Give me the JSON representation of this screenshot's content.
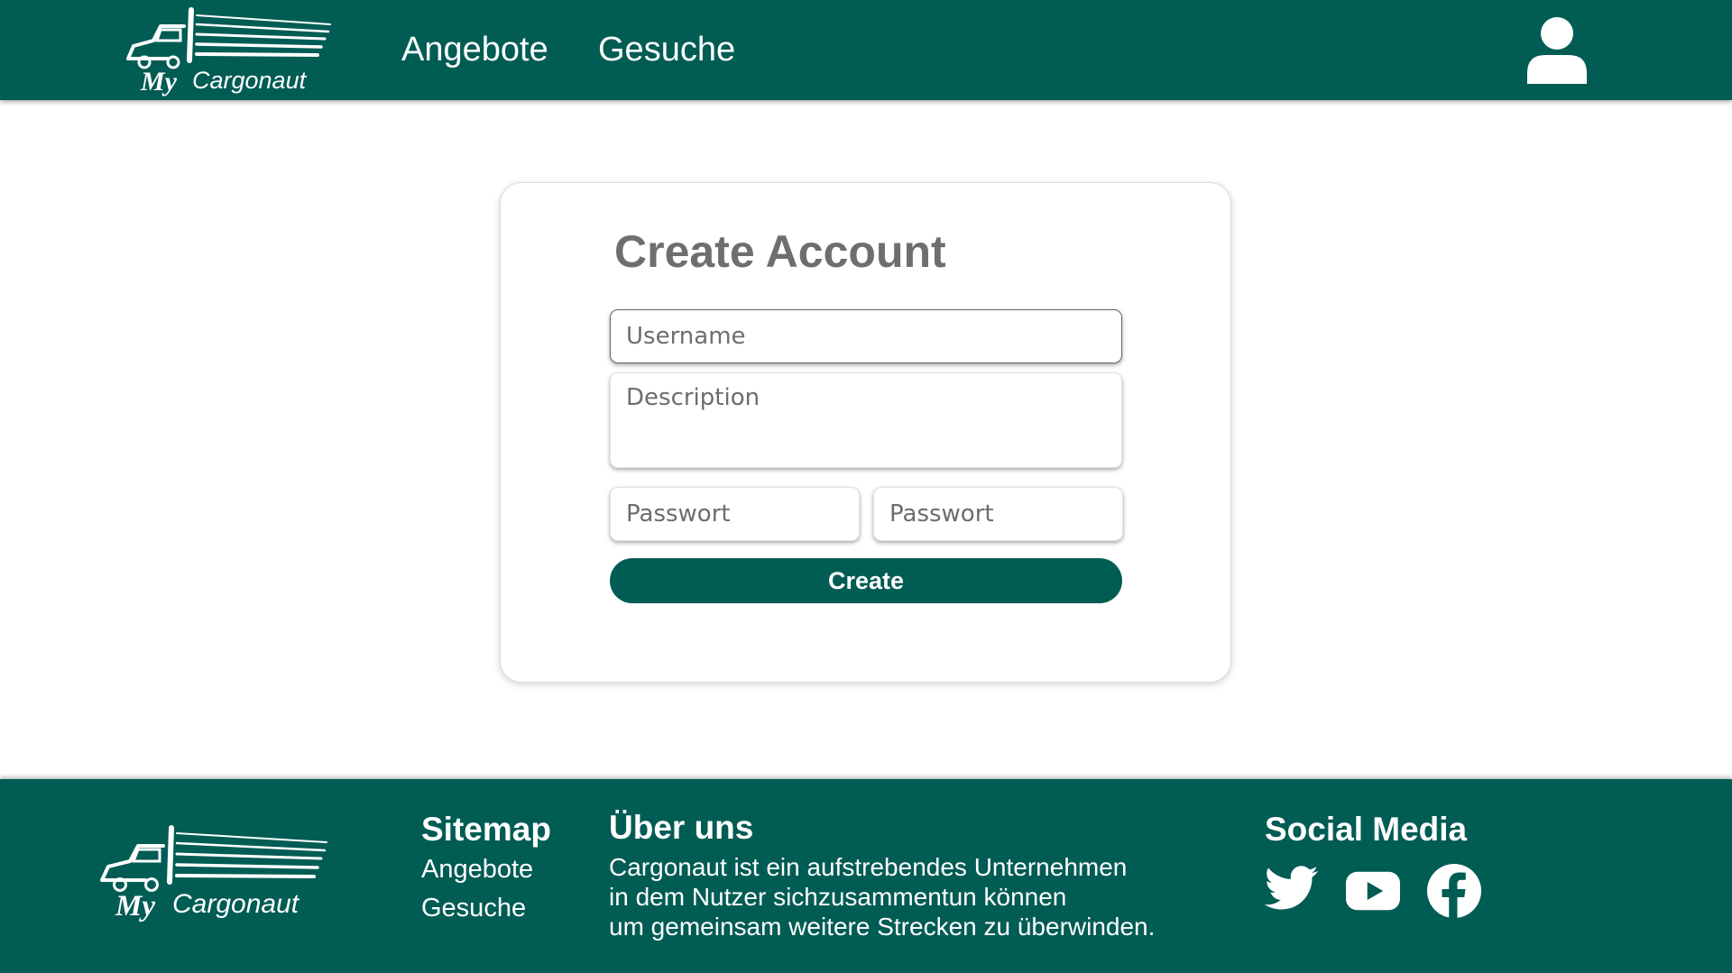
{
  "brand": {
    "logo_prefix": "My",
    "logo_name": "Cargonaut"
  },
  "nav": {
    "items": [
      {
        "label": "Angebote"
      },
      {
        "label": "Gesuche"
      }
    ],
    "user_icon": "user-icon"
  },
  "form": {
    "title": "Create Account",
    "username_placeholder": "Username",
    "description_placeholder": "Description",
    "password_placeholder": "Passwort",
    "password_repeat_placeholder": "Passwort",
    "submit_label": "Create"
  },
  "footer": {
    "sitemap": {
      "heading": "Sitemap",
      "links": [
        {
          "label": "Angebote"
        },
        {
          "label": "Gesuche"
        }
      ]
    },
    "about": {
      "heading": "Über uns",
      "lines": [
        "Cargonaut ist ein aufstrebendes Unternehmen",
        "in dem Nutzer sichzusammentun können",
        "um gemeinsam weitere Strecken zu überwinden."
      ]
    },
    "social": {
      "heading": "Social Media",
      "icons": [
        "twitter-icon",
        "youtube-icon",
        "facebook-icon"
      ]
    }
  },
  "colors": {
    "primary": "#015c54",
    "title_gray": "#6e6e6e",
    "white": "#ffffff"
  }
}
